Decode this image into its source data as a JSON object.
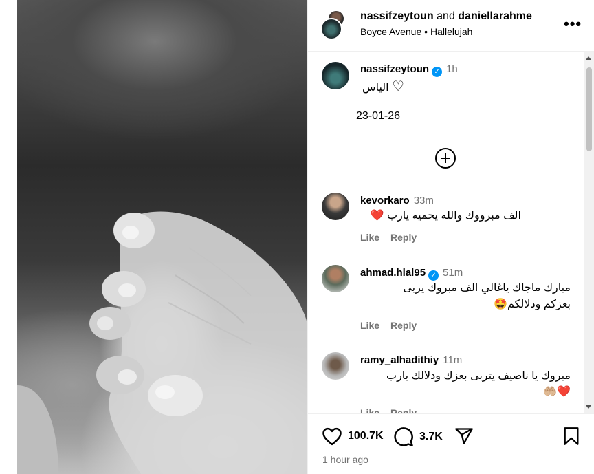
{
  "header": {
    "user1": "nassifzeytoun",
    "and": "and",
    "user2": "daniellarahme",
    "audio_artist": "Boyce Avenue",
    "separator": "•",
    "audio_track": "Hallelujah",
    "more_icon": "more-horizontal-icon"
  },
  "post": {
    "author": "nassifzeytoun",
    "verified": true,
    "time": "1h",
    "caption_line1": "الياس",
    "caption_heart": "♡",
    "caption_line2": "23-01-26"
  },
  "comments": [
    {
      "user": "kevorkaro",
      "verified": false,
      "time": "33m",
      "text": "الف مبرووك والله يحميه يارب",
      "emoji": "❤️",
      "like": "Like",
      "reply": "Reply"
    },
    {
      "user": "ahmad.hlal95",
      "verified": true,
      "time": "51m",
      "text_line1": "مبارك ماجاك ياغالي الف مبروك يربى",
      "text_line2": "بعزكم ودلالكم",
      "emoji": "🤩",
      "like": "Like",
      "reply": "Reply"
    },
    {
      "user": "ramy_alhadithiy",
      "verified": false,
      "time": "11m",
      "text_line1": "مبروك يا ناصيف يتربى بعزك ودلالك يارب",
      "emoji": "❤️🤲🏼",
      "like": "Like",
      "reply": "Reply"
    }
  ],
  "actions": {
    "likes": "100.7K",
    "comments": "3.7K",
    "posted": "1 hour ago"
  },
  "colors": {
    "verified": "#0095f6",
    "muted": "#737373",
    "heart_red": "#ed2a3a"
  }
}
